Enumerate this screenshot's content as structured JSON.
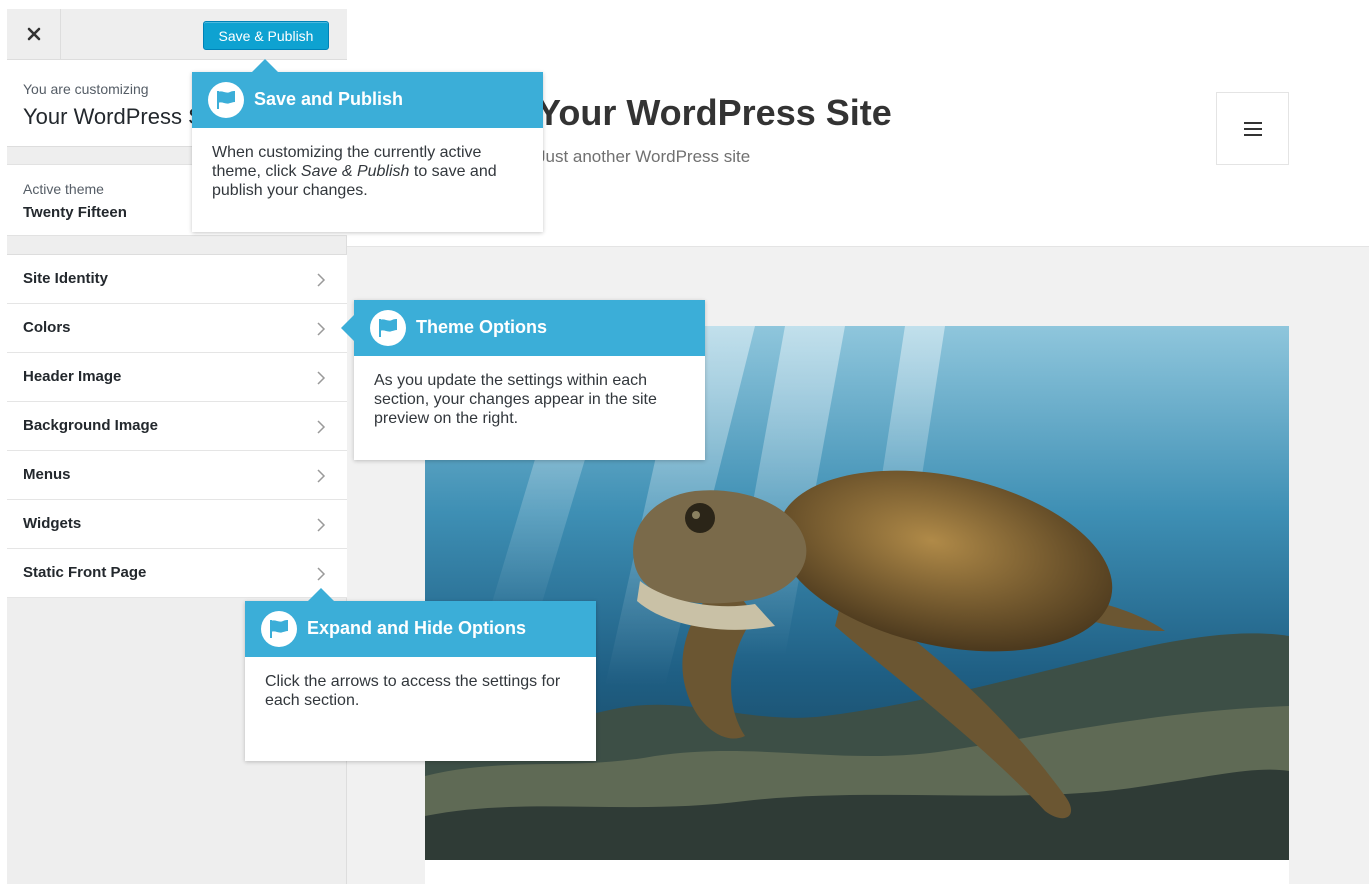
{
  "customizer": {
    "close_icon": "close-icon",
    "publish_label": "Save & Publish",
    "customizing_label": "You are customizing",
    "site_name": "Your WordPress Site",
    "active_theme_label": "Active theme",
    "active_theme_name": "Twenty Fifteen",
    "sections": [
      {
        "label": "Site Identity"
      },
      {
        "label": "Colors"
      },
      {
        "label": "Header Image"
      },
      {
        "label": "Background Image"
      },
      {
        "label": "Menus"
      },
      {
        "label": "Widgets"
      },
      {
        "label": "Static Front Page"
      }
    ]
  },
  "preview": {
    "site_title": "Your WordPress Site",
    "site_tagline": "Just another WordPress site",
    "menu_icon": "hamburger-icon",
    "featured_image": "sea-turtle-underwater-photo"
  },
  "tooltips": {
    "publish": {
      "title": "Save and Publish",
      "body_prefix": "When customizing the currently active theme, click ",
      "body_emphasis": "Save & Publish",
      "body_suffix": " to save and publish your changes."
    },
    "theme_options": {
      "title": "Theme Options",
      "body": "As you update the settings within each section, your changes appear in the site preview on the right."
    },
    "expand": {
      "title": "Expand and Hide Options",
      "body": "Click the arrows to access the settings for each section."
    }
  },
  "colors": {
    "publish_button": "#0ea2d1",
    "tooltip_header": "#3baed8"
  }
}
